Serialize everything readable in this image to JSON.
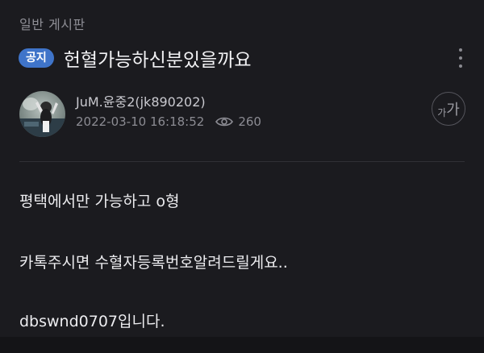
{
  "board": {
    "name": "일반 게시판"
  },
  "post": {
    "badge": "공지",
    "title": "헌혈가능하신분있을까요",
    "author": "JuM.윤중2(jk890202)",
    "date": "2022-03-10 16:18:52",
    "views": "260",
    "font_size_label_small": "가",
    "font_size_label_big": "가",
    "body_lines": [
      "평택에서만 가능하고  o형",
      "카톡주시면 수혈자등록번호알려드릴게요..",
      "dbswnd0707입니다."
    ]
  },
  "colors": {
    "background": "#1b1b1f",
    "badge": "#3f74c9",
    "muted_text": "#8c8c93"
  },
  "icons": {
    "more": "more-vertical-icon",
    "views": "eye-icon"
  }
}
